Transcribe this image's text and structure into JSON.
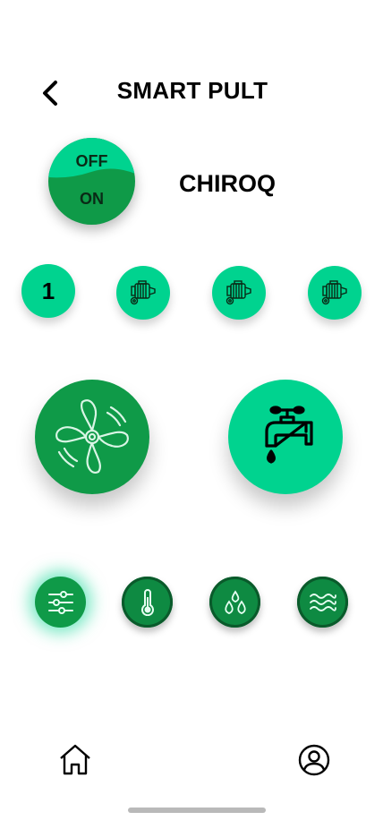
{
  "header": {
    "title": "SMART PULT",
    "back_icon": "chevron-left-icon"
  },
  "power": {
    "off_label": "OFF",
    "on_label": "ON",
    "state": "on"
  },
  "device": {
    "name": "CHIROQ"
  },
  "modes": [
    {
      "label": "1",
      "icon": null
    },
    {
      "label": "",
      "icon": "motor-icon"
    },
    {
      "label": "",
      "icon": "motor-icon"
    },
    {
      "label": "",
      "icon": "motor-icon"
    }
  ],
  "actions": [
    {
      "id": "fan",
      "icon": "fan-icon"
    },
    {
      "id": "tap",
      "icon": "water-tap-icon"
    }
  ],
  "settings": [
    {
      "icon": "sliders-icon",
      "active": true
    },
    {
      "icon": "thermometer-icon",
      "active": false
    },
    {
      "icon": "water-drops-icon",
      "active": false
    },
    {
      "icon": "waves-icon",
      "active": false
    }
  ],
  "nav": [
    {
      "icon": "home-icon"
    },
    {
      "icon": "profile-icon"
    }
  ],
  "colors": {
    "accent": "#00d38f",
    "dark_green": "#0f9a48",
    "text": "#000000"
  }
}
